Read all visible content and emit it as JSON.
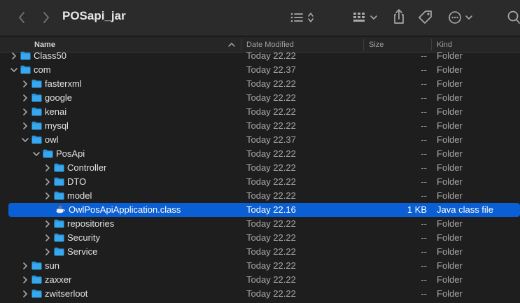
{
  "window": {
    "title": "POSapi_jar"
  },
  "toolbar": {
    "back_icon": "chevron-left-icon",
    "forward_icon": "chevron-right-icon",
    "view_icon": "list-view-icon",
    "group_icon": "grid-group-icon",
    "share_icon": "share-icon",
    "tag_icon": "tag-icon",
    "action_icon": "ellipsis-circle-icon",
    "search_icon": "search-icon"
  },
  "columns": {
    "name": "Name",
    "date": "Date Modified",
    "size": "Size",
    "kind": "Kind"
  },
  "rows": [
    {
      "name": "Class50",
      "date": "Today 22.22",
      "size": "--",
      "kind": "Folder",
      "depth": 1,
      "type": "folder",
      "expanded": false,
      "selected": false
    },
    {
      "name": "com",
      "date": "Today 22.37",
      "size": "--",
      "kind": "Folder",
      "depth": 1,
      "type": "folder",
      "expanded": true,
      "selected": false
    },
    {
      "name": "fasterxml",
      "date": "Today 22.22",
      "size": "--",
      "kind": "Folder",
      "depth": 2,
      "type": "folder",
      "expanded": false,
      "selected": false
    },
    {
      "name": "google",
      "date": "Today 22.22",
      "size": "--",
      "kind": "Folder",
      "depth": 2,
      "type": "folder",
      "expanded": false,
      "selected": false
    },
    {
      "name": "kenai",
      "date": "Today 22.22",
      "size": "--",
      "kind": "Folder",
      "depth": 2,
      "type": "folder",
      "expanded": false,
      "selected": false
    },
    {
      "name": "mysql",
      "date": "Today 22.22",
      "size": "--",
      "kind": "Folder",
      "depth": 2,
      "type": "folder",
      "expanded": false,
      "selected": false
    },
    {
      "name": "owl",
      "date": "Today 22.37",
      "size": "--",
      "kind": "Folder",
      "depth": 2,
      "type": "folder",
      "expanded": true,
      "selected": false
    },
    {
      "name": "PosApi",
      "date": "Today 22.22",
      "size": "--",
      "kind": "Folder",
      "depth": 3,
      "type": "folder",
      "expanded": true,
      "selected": false
    },
    {
      "name": "Controller",
      "date": "Today 22.22",
      "size": "--",
      "kind": "Folder",
      "depth": 4,
      "type": "folder",
      "expanded": false,
      "selected": false
    },
    {
      "name": "DTO",
      "date": "Today 22.22",
      "size": "--",
      "kind": "Folder",
      "depth": 4,
      "type": "folder",
      "expanded": false,
      "selected": false
    },
    {
      "name": "model",
      "date": "Today 22.22",
      "size": "--",
      "kind": "Folder",
      "depth": 4,
      "type": "folder",
      "expanded": false,
      "selected": false
    },
    {
      "name": "OwlPosApiApplication.class",
      "date": "Today 22.16",
      "size": "1 KB",
      "kind": "Java class file",
      "depth": 4,
      "type": "file",
      "expanded": false,
      "selected": true
    },
    {
      "name": "repositories",
      "date": "Today 22.22",
      "size": "--",
      "kind": "Folder",
      "depth": 4,
      "type": "folder",
      "expanded": false,
      "selected": false
    },
    {
      "name": "Security",
      "date": "Today 22.22",
      "size": "--",
      "kind": "Folder",
      "depth": 4,
      "type": "folder",
      "expanded": false,
      "selected": false
    },
    {
      "name": "Service",
      "date": "Today 22.22",
      "size": "--",
      "kind": "Folder",
      "depth": 4,
      "type": "folder",
      "expanded": false,
      "selected": false
    },
    {
      "name": "sun",
      "date": "Today 22.22",
      "size": "--",
      "kind": "Folder",
      "depth": 2,
      "type": "folder",
      "expanded": false,
      "selected": false
    },
    {
      "name": "zaxxer",
      "date": "Today 22.22",
      "size": "--",
      "kind": "Folder",
      "depth": 2,
      "type": "folder",
      "expanded": false,
      "selected": false
    },
    {
      "name": "zwitserloot",
      "date": "Today 22.22",
      "size": "--",
      "kind": "Folder",
      "depth": 2,
      "type": "folder",
      "expanded": false,
      "selected": false
    }
  ],
  "colors": {
    "folder": "#35a8f0",
    "folder_tab": "#2b92d9",
    "selection": "#0a5fd4",
    "background": "#1e1e1e"
  }
}
